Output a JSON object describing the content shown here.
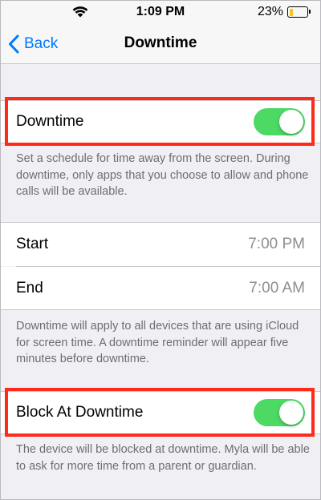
{
  "status_bar": {
    "time": "1:09 PM",
    "battery_percent": "23%",
    "battery_level": 0.23,
    "wifi_icon": "wifi-icon"
  },
  "nav": {
    "back_label": "Back",
    "title": "Downtime",
    "back_icon": "chevron-left-icon"
  },
  "downtime_toggle": {
    "label": "Downtime",
    "state": "on",
    "description": "Set a schedule for time away from the screen. During downtime, only apps that you choose to allow and phone calls will be available."
  },
  "schedule": {
    "start_label": "Start",
    "start_value": "7:00 PM",
    "end_label": "End",
    "end_value": "7:00 AM",
    "description": "Downtime will apply to all devices that are using iCloud for screen time. A downtime reminder will appear five minutes before downtime."
  },
  "block_toggle": {
    "label": "Block At Downtime",
    "state": "on",
    "description": "The device will be blocked at downtime. Myla will be able to ask for more time from a parent or guardian."
  },
  "colors": {
    "accent": "#007aff",
    "toggle_on": "#4cd964",
    "highlight": "#ff2a1a",
    "background": "#efeff4"
  }
}
